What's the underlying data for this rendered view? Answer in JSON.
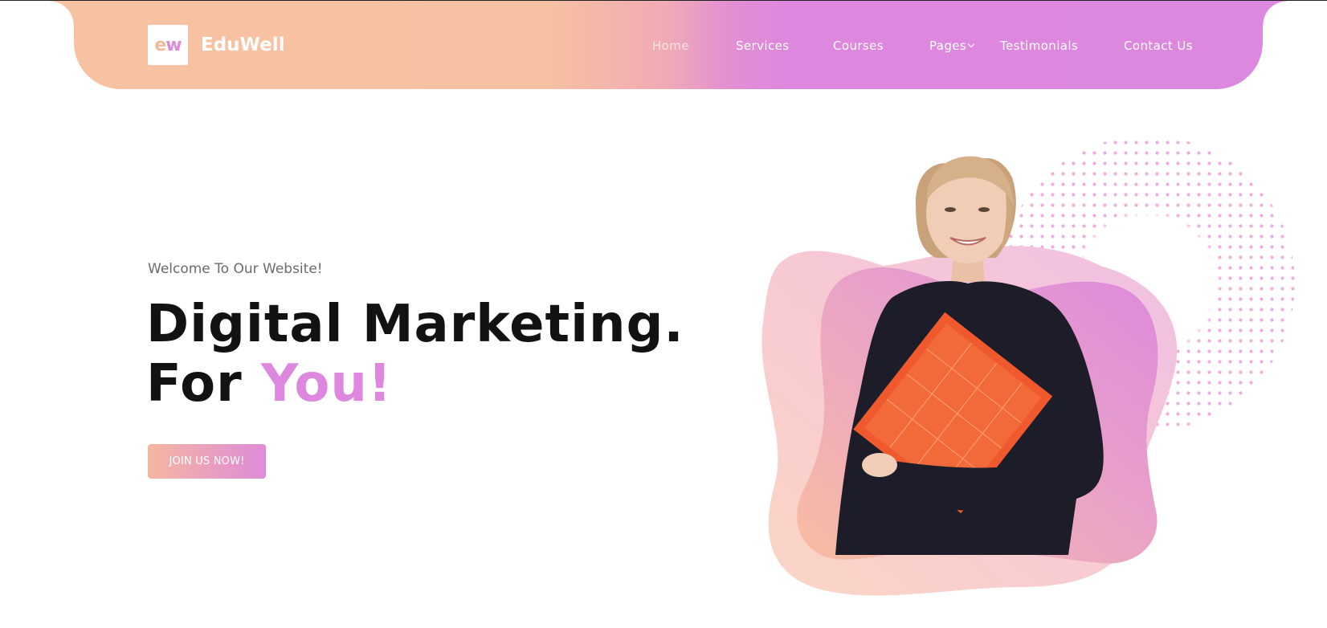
{
  "brand": {
    "logo_letters": [
      "e",
      "w"
    ],
    "name": "EduWell"
  },
  "nav": {
    "items": [
      {
        "label": "Home",
        "active": true
      },
      {
        "label": "Services"
      },
      {
        "label": "Courses"
      },
      {
        "label": "Pages",
        "has_dropdown": true
      },
      {
        "label": "Testimonials"
      },
      {
        "label": "Contact Us"
      }
    ]
  },
  "hero": {
    "welcome": "Welcome To Our Website!",
    "headline_line1": "Digital Marketing.",
    "headline_line2_prefix": "For ",
    "headline_line2_accent": "You!",
    "cta_label": "JOIN US NOW!"
  },
  "colors": {
    "peach": "#f7c2a2",
    "orchid": "#dd88de",
    "heading": "#121212",
    "body_text": "#6b6b6b"
  },
  "icons": {
    "dropdown": "chevron-down-icon",
    "hero_art": "woman-with-folder-illustration"
  }
}
